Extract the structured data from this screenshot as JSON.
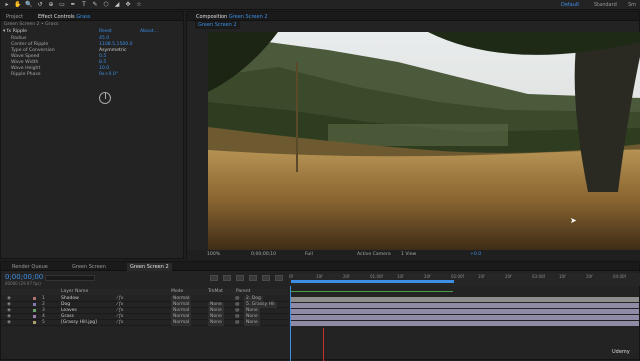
{
  "toolbar": {
    "tools": [
      "▸",
      "✋",
      "🔍",
      "↺",
      "⊕",
      "▭",
      "✒",
      "T",
      "✎",
      "⬡",
      "◢",
      "✥",
      "☆"
    ],
    "workspaces": {
      "default": "Default",
      "standard": "Standard",
      "small": "Sm"
    }
  },
  "project_panel": {
    "tab": "Project",
    "effect_tab_prefix": "Effect Controls",
    "effect_tab_layer": "Grass"
  },
  "effect_controls": {
    "breadcrumb": "Green Screen 2 • Grass",
    "effect_name": "Ripple",
    "reset": "Reset",
    "about": "About...",
    "props": [
      {
        "name": "Radius",
        "value": "45.0"
      },
      {
        "name": "Center of Ripple",
        "value": "1108.5,1500.0"
      },
      {
        "name": "Type of Conversion",
        "value": "Asymmetric"
      },
      {
        "name": "Wave Speed",
        "value": "0.5"
      },
      {
        "name": "Wave Width",
        "value": "8.5"
      },
      {
        "name": "Wave Height",
        "value": "10.0"
      },
      {
        "name": "Ripple Phase",
        "value": "0x+0.0°"
      }
    ]
  },
  "comp_panel": {
    "tab_prefix": "Composition",
    "tab_name": "Green Screen 2",
    "sub_tab": "Green Screen 2"
  },
  "viewer_bar": {
    "zoom": "100%",
    "time": "0;00;00;10",
    "res": "Full",
    "camera": "Active Camera",
    "views": "1 View",
    "offset": "+0.0"
  },
  "timeline_tabs": [
    "Render Queue",
    "Green Screen",
    "Green Screen 2"
  ],
  "timeline": {
    "timecode": "0;00;00;00",
    "fps": "00000 (29.97 fps)",
    "columns": {
      "name": "Layer Name",
      "mode": "Mode",
      "trkmat": "TrkMat",
      "parent": "Parent"
    },
    "layers": [
      {
        "num": "1",
        "name": "Shadow",
        "mode": "Normal",
        "trkmat": "",
        "parent": "2. Dog"
      },
      {
        "num": "2",
        "name": "Dog",
        "mode": "Normal",
        "trkmat": "None",
        "parent": "5. Grassy Hil"
      },
      {
        "num": "3",
        "name": "Leaves",
        "mode": "Normal",
        "trkmat": "None",
        "parent": "None"
      },
      {
        "num": "4",
        "name": "Grass",
        "mode": "Normal",
        "trkmat": "None",
        "parent": "None"
      },
      {
        "num": "5",
        "name": "[Grassy Hill.jpg]",
        "mode": "Normal",
        "trkmat": "None",
        "parent": "None"
      }
    ],
    "ruler": [
      "0f",
      "10f",
      "20f",
      "01:00f",
      "10f",
      "20f",
      "02:00f",
      "10f",
      "20f",
      "03:00f",
      "10f",
      "20f",
      "04:00f"
    ]
  },
  "watermark": "Udemy"
}
